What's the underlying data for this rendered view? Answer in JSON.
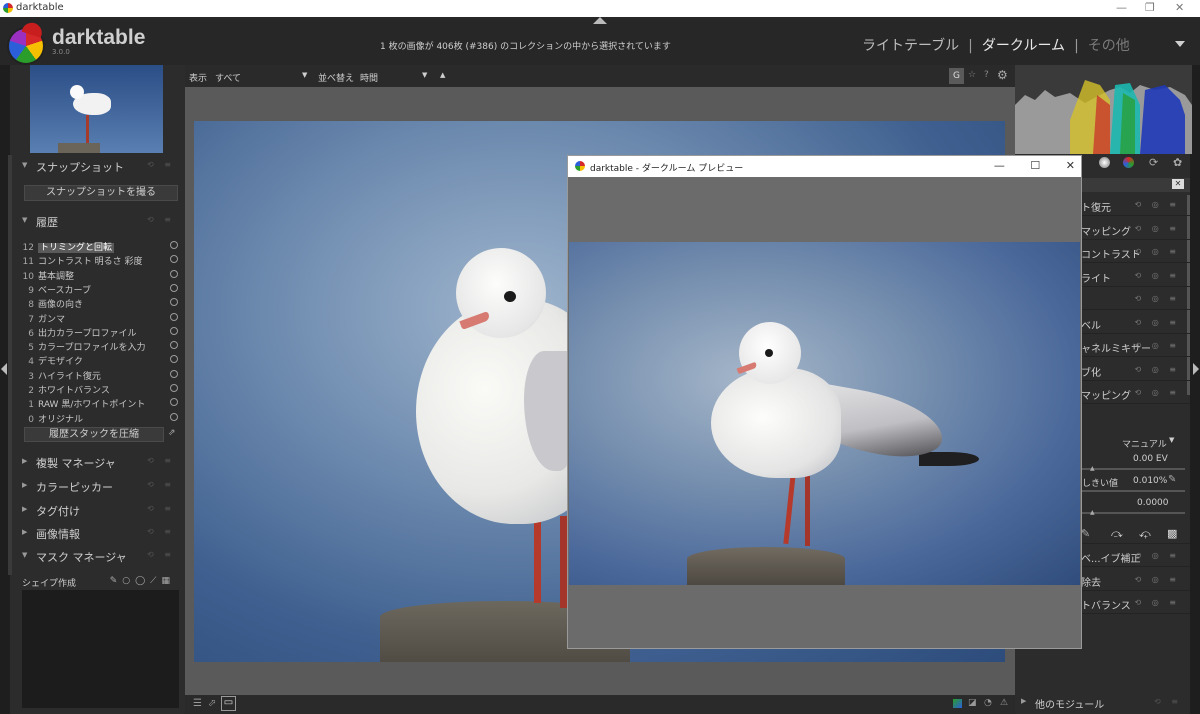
{
  "app": {
    "window_title": "darktable",
    "brand": "darktable",
    "version": "3.0.0",
    "collection_message": "1 枚の画像が 406枚 (#386) のコレクションの中から選択されています",
    "views": [
      "ライトテーブル",
      "ダークルーム",
      "その他"
    ],
    "view_separator": "|"
  },
  "topbar": {
    "display_label": "表示",
    "display_value": "すべて",
    "sort_label": "並べ替え",
    "sort_value": "時間",
    "g_button": "G",
    "star_icon": "☆",
    "help_icon": "?",
    "gear_icon": "⚙"
  },
  "left": {
    "snapshots_title": "スナップショット",
    "snapshot_button": "スナップショットを撮る",
    "history_title": "履歴",
    "history": [
      {
        "n": "12",
        "label": "トリミングと回転",
        "selected": true
      },
      {
        "n": "11",
        "label": "コントラスト 明るさ 彩度"
      },
      {
        "n": "10",
        "label": "基本調整"
      },
      {
        "n": "9",
        "label": "ベースカーブ"
      },
      {
        "n": "8",
        "label": "画像の向き"
      },
      {
        "n": "7",
        "label": "ガンマ"
      },
      {
        "n": "6",
        "label": "出力カラープロファイル"
      },
      {
        "n": "5",
        "label": "カラープロファイルを入力"
      },
      {
        "n": "4",
        "label": "デモザイク"
      },
      {
        "n": "3",
        "label": "ハイライト復元"
      },
      {
        "n": "2",
        "label": "ホワイトバランス"
      },
      {
        "n": "1",
        "label": "RAW 黒/ホワイトポイント"
      },
      {
        "n": "0",
        "label": "オリジナル"
      }
    ],
    "compress_button": "履歴スタックを圧縮",
    "duplicate_manager": "複製 マネージャ",
    "color_picker": "カラーピッカー",
    "tagging": "タグ付け",
    "image_info": "画像情報",
    "mask_manager": "マスク マネージャ",
    "shape_create": "シェイプ作成"
  },
  "right": {
    "modules": [
      "ト復元",
      "マッピング",
      "コントラスト",
      "ライト",
      "",
      "ベル",
      "ャネルミキサー",
      "ブ化",
      "マッピング"
    ],
    "mode_value": "マニュアル",
    "exposure_value": "0.00 EV",
    "threshold_label": "しきい値",
    "threshold_value": "0.010%",
    "offset_value": "0.0000",
    "modules2": [
      "ベ...イブ補正",
      "除去",
      "トバランス"
    ],
    "more_modules": "他のモジュール"
  },
  "preview": {
    "title": "darktable - ダークルーム プレビュー",
    "minimize": "—",
    "maximize": "☐",
    "close": "✕"
  },
  "colors": {
    "accent_red": "#c81e1e"
  }
}
